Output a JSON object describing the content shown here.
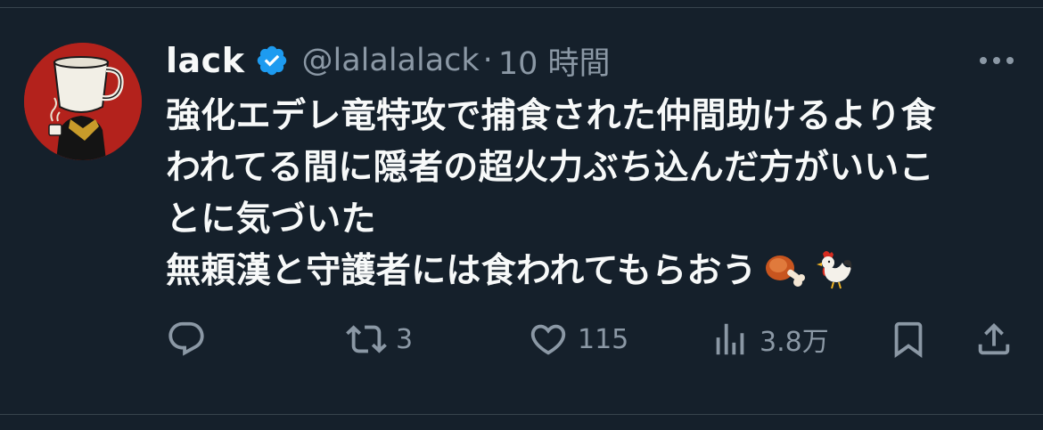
{
  "tweet": {
    "display_name": "lack",
    "verified_icon": "verified-badge-icon",
    "handle": "@lalalalack",
    "separator": "·",
    "time": "10 時間",
    "text_lines": [
      "強化エデレ竜特攻で捕食された仲間助けるより食",
      "われてる間に隠者の超火力ぶち込んだ方がいいこ",
      "とに気づいた",
      "無頼漢と守護者には食われてもらおう"
    ],
    "emojis": [
      "meat-on-bone-emoji",
      "rooster-emoji"
    ]
  },
  "actions": {
    "reply": {
      "icon": "reply-icon"
    },
    "retweet": {
      "icon": "retweet-icon",
      "count": "3"
    },
    "like": {
      "icon": "heart-icon",
      "count": "115"
    },
    "views": {
      "icon": "views-chart-icon",
      "count": "3.8万"
    },
    "bookmark": {
      "icon": "bookmark-icon"
    },
    "share": {
      "icon": "share-icon"
    }
  },
  "colors": {
    "background": "#15202b",
    "text": "#f7f9f9",
    "secondary_text": "#8b98a5",
    "verified": "#1d9bf0",
    "divider": "#38444d"
  }
}
